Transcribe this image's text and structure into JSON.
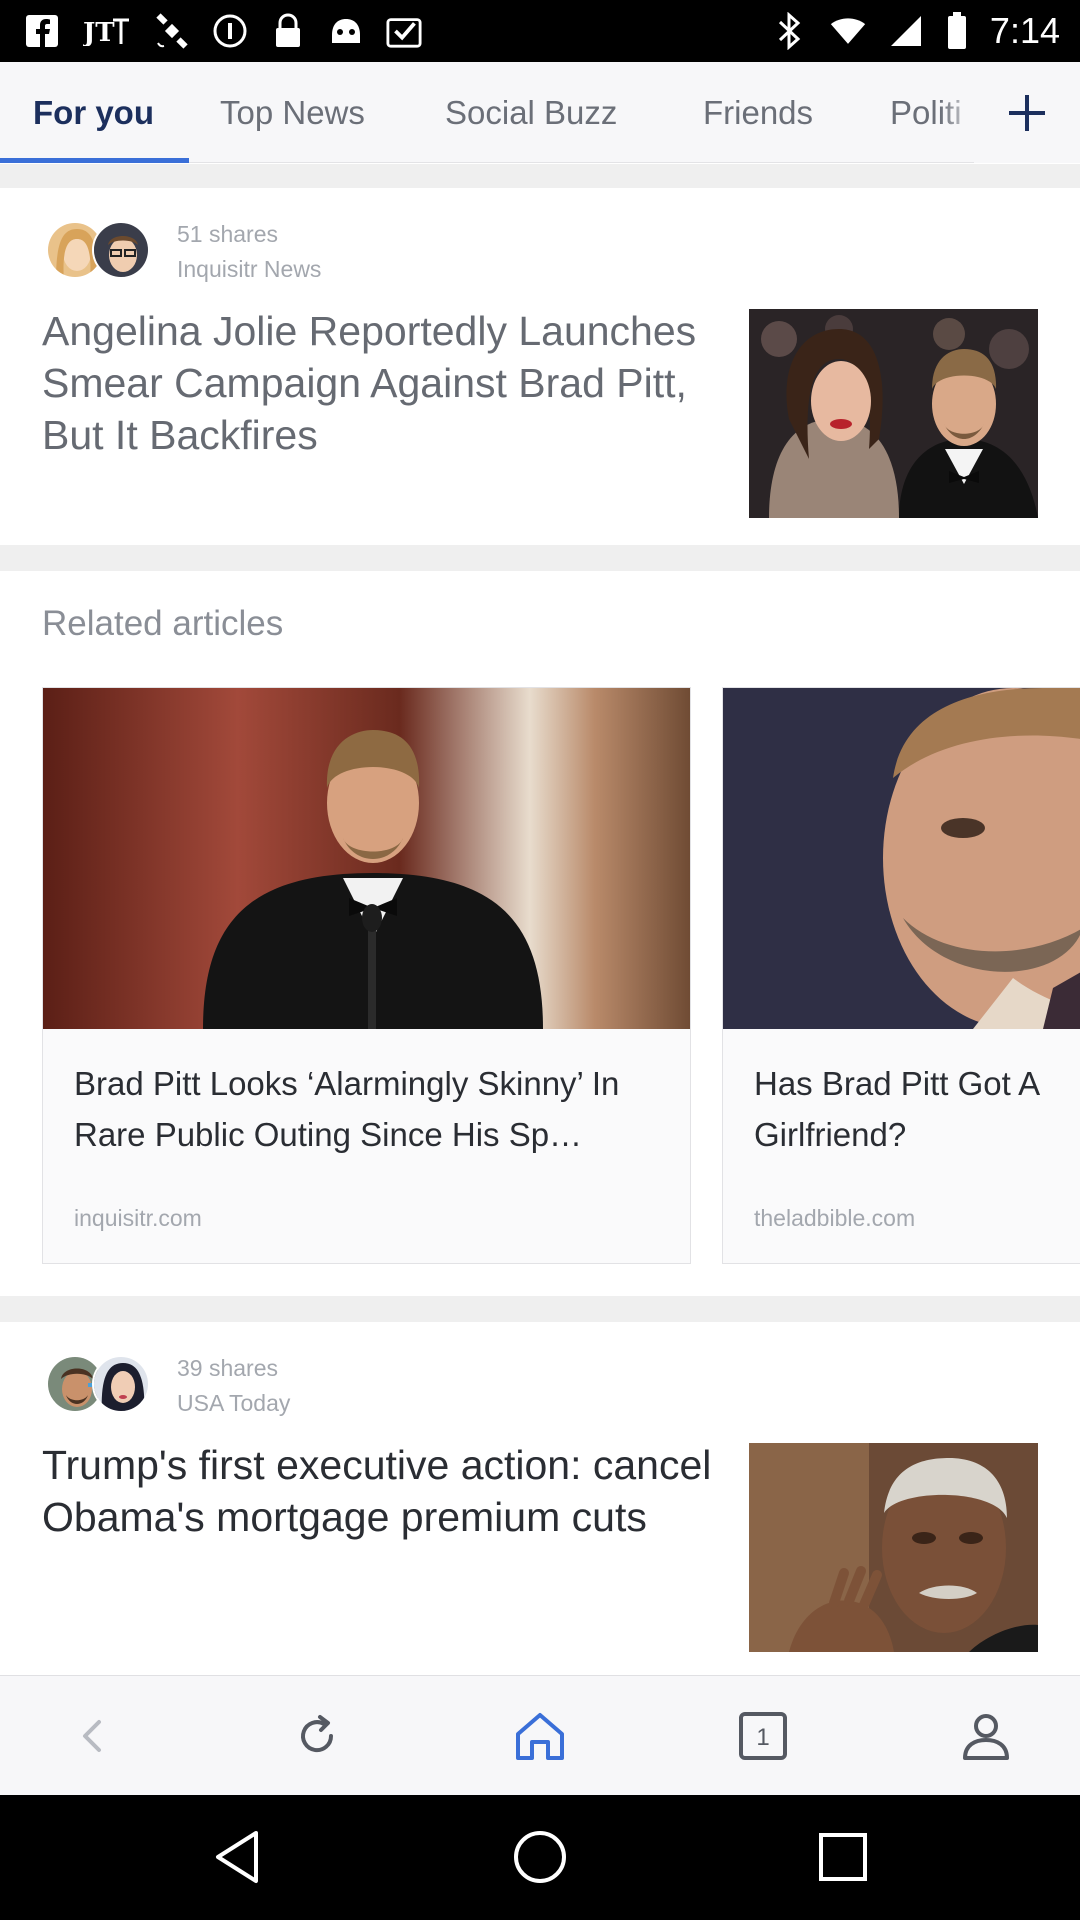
{
  "status_bar": {
    "time": "7:14",
    "left_icons": [
      "facebook-icon",
      "jt-icon",
      "satellite-icon",
      "info-icon",
      "lock-icon",
      "bot-icon",
      "clipboard-check-icon"
    ],
    "right_icons": [
      "bluetooth-icon",
      "wifi-icon",
      "signal-icon",
      "battery-icon"
    ]
  },
  "tabs": {
    "items": [
      {
        "label": "For you",
        "active": true
      },
      {
        "label": "Top News",
        "active": false
      },
      {
        "label": "Social Buzz",
        "active": false
      },
      {
        "label": "Friends",
        "active": false
      },
      {
        "label": "Politi",
        "active": false
      }
    ],
    "add_icon": "plus-icon",
    "accent_color": "#3a6fd8"
  },
  "feed": {
    "story1": {
      "shares": "51 shares",
      "source": "Inquisitr News",
      "headline": "Angelina Jolie Reportedly Launches Smear Campaign Against Brad Pitt, But It Backfires"
    },
    "related": {
      "title": "Related articles",
      "items": [
        {
          "title": "Brad Pitt Looks ‘Alarmingly Skinny’ In Rare Public Outing Since His Sp…",
          "source": "inquisitr.com"
        },
        {
          "title": "Has Brad Pitt Got A Girlfriend?",
          "source": "theladbible.com"
        }
      ]
    },
    "story2": {
      "shares": "39 shares",
      "source": "USA Today",
      "headline": "Trump's first executive action: cancel Obama's mortgage premium cuts"
    }
  },
  "bottom_nav": {
    "items": [
      "back-icon",
      "refresh-icon",
      "home-icon",
      "tabs-count-icon",
      "profile-icon"
    ],
    "tab_count": "1",
    "active_color": "#3a6fd8"
  },
  "system_nav": [
    "system-back-icon",
    "system-home-icon",
    "system-recents-icon"
  ]
}
